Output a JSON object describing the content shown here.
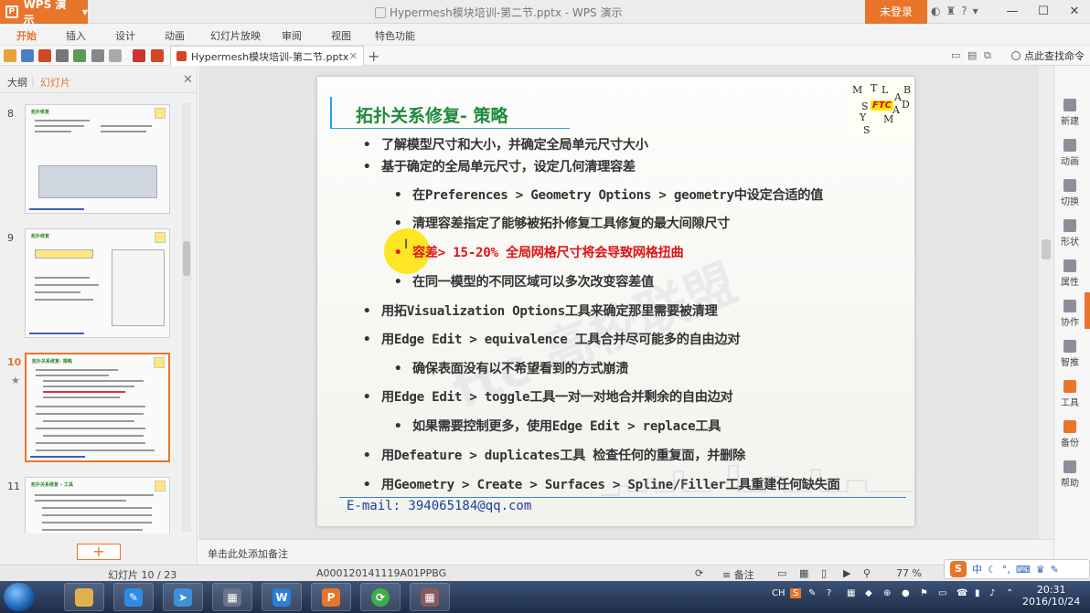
{
  "app": {
    "name": "WPS 演示",
    "doc_title": "Hypermesh模块培训-第二节.pptx - WPS 演示",
    "login_label": "未登录"
  },
  "menu": {
    "items": [
      "开始",
      "插入",
      "设计",
      "动画",
      "幻灯片放映",
      "审阅",
      "视图",
      "特色功能"
    ],
    "active_index": 0
  },
  "tabbar": {
    "doc_tab": "Hypermesh模块培训-第二节.pptx",
    "search_label": "点此查找命令"
  },
  "left_panel": {
    "tabs": [
      "大纲",
      "幻灯片"
    ],
    "active_tab": 1,
    "thumbnails": [
      {
        "num": "8",
        "title": "拓扑修复"
      },
      {
        "num": "9",
        "title": "拓扑修复"
      },
      {
        "num": "10",
        "title": "拓扑关系修复- 策略"
      },
      {
        "num": "11",
        "title": "拓扑关系修复 – 工具"
      }
    ],
    "selected_num": "10",
    "add_label": "+"
  },
  "slide": {
    "title": "拓扑关系修复- 策略",
    "logo_letters": [
      "M",
      "T",
      "L",
      "A",
      "B",
      "S",
      "A",
      "D",
      "Y",
      "M",
      "S"
    ],
    "logo_ftc": "FTC",
    "bullets": [
      {
        "level": 1,
        "text": "了解模型尺寸和大小，并确定全局单元尺寸大小"
      },
      {
        "level": 1,
        "text": "基于确定的全局单元尺寸，设定几何清理容差"
      },
      {
        "level": 2,
        "text": "在Preferences > Geometry Options > geometry中设定合适的值"
      },
      {
        "level": 2,
        "text": "清理容差指定了能够被拓扑修复工具修复的最大间隙尺寸"
      },
      {
        "level": 2,
        "text": "容差> 15-20% 全局网格尺寸将会导致网格扭曲",
        "red": true
      },
      {
        "level": 2,
        "text": "在同一模型的不同区域可以多次改变容差值"
      },
      {
        "level": 1,
        "text": "用拓Visualization Options工具来确定那里需要被清理"
      },
      {
        "level": 1,
        "text": "用Edge Edit  > equivalence 工具合并尽可能多的自由边对"
      },
      {
        "level": 2,
        "text": "确保表面没有以不希望看到的方式崩溃"
      },
      {
        "level": 1,
        "text": "用Edge Edit  > toggle工具一对一对地合并剩余的自由边对"
      },
      {
        "level": 2,
        "text": "如果需要控制更多，使用Edge Edit  > replace工具"
      },
      {
        "level": 1,
        "text": "用Defeature > duplicates工具 检查任何的重复面，并删除"
      },
      {
        "level": 1,
        "text": "用Geometry > Create > Surfaces > Spline/Filler工具重建任何缺失面"
      }
    ],
    "email": "E-mail: 394065184@qq.com"
  },
  "right_toolbar": {
    "items": [
      "新建",
      "动画",
      "切换",
      "形状",
      "属性",
      "协作",
      "智推",
      "工具",
      "备份",
      "帮助"
    ]
  },
  "notes": {
    "placeholder": "单击此处添加备注"
  },
  "status": {
    "slide_counter": "幻灯片 10 / 23",
    "template_id": "A000120141119A01PPBG",
    "notes_label": "备注",
    "zoom": "77 %"
  },
  "tray_widget": {
    "lang": "中"
  },
  "taskbar": {
    "lang": "CH",
    "time": "20:31",
    "date": "2016/10/24"
  }
}
